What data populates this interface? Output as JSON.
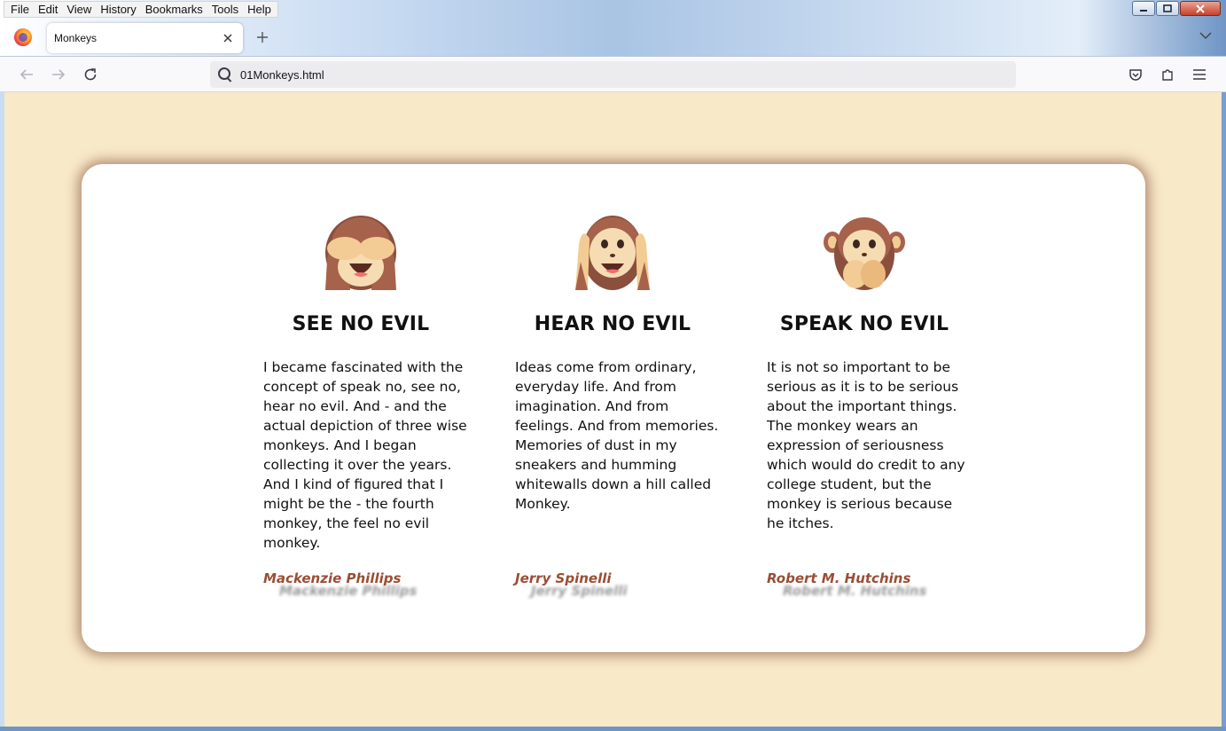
{
  "menu": {
    "items": [
      "File",
      "Edit",
      "View",
      "History",
      "Bookmarks",
      "Tools",
      "Help"
    ]
  },
  "tab": {
    "title": "Monkeys"
  },
  "toolbar": {
    "url": "01Monkeys.html"
  },
  "colors": {
    "page_bg": "#f8e9c8",
    "author": "#9a4e35",
    "card_shadow": "#783a28"
  },
  "monkeys": [
    {
      "icon": "see-no-evil-monkey-icon",
      "title": "SEE NO EVIL",
      "quote": "I became fascinated with the concept of speak no, see no, hear no evil. And - and the actual depiction of three wise monkeys. And I began collecting it over the years. And I kind of figured that I might be the - the fourth monkey, the feel no evil monkey.",
      "author": "Mackenzie Phillips"
    },
    {
      "icon": "hear-no-evil-monkey-icon",
      "title": "HEAR NO EVIL",
      "quote": "Ideas come from ordinary, everyday life. And from imagination. And from feelings. And from memories. Memories of dust in my sneakers and humming whitewalls down a hill called Monkey.",
      "author": "Jerry Spinelli"
    },
    {
      "icon": "speak-no-evil-monkey-icon",
      "title": "SPEAK NO EVIL",
      "quote": "It is not so important to be serious as it is to be serious about the important things. The monkey wears an expression of seriousness which would do credit to any college student, but the monkey is serious because he itches.",
      "author": "Robert M. Hutchins"
    }
  ]
}
